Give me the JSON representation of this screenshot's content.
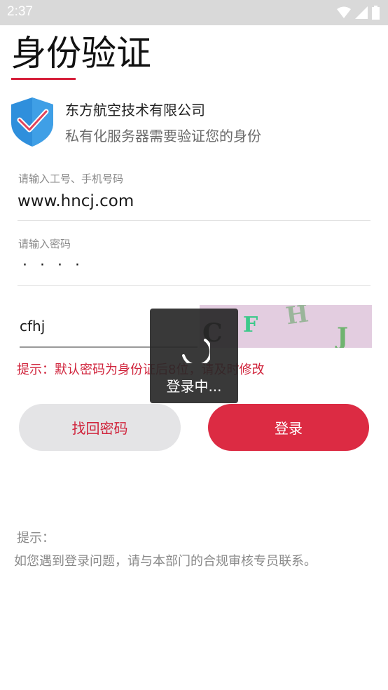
{
  "status_bar": {
    "time": "2:37"
  },
  "page": {
    "title": "身份验证"
  },
  "company": {
    "name": "东方航空技术有限公司",
    "description": "私有化服务器需要验证您的身份"
  },
  "form": {
    "account": {
      "label": "请输入工号、手机号码",
      "value": "www.hncj.com"
    },
    "password": {
      "label": "请输入密码",
      "masked": "····"
    },
    "captcha": {
      "value": "cfhj",
      "image_text": [
        "C",
        "F",
        "H",
        "J"
      ]
    },
    "hint": "提示：默认密码为身份证后8位，请及时修改"
  },
  "buttons": {
    "forgot": "找回密码",
    "login": "登录"
  },
  "notes": {
    "title": "提示：",
    "body": "如您遇到登录问题，请与本部门的合规审核专员联系。"
  },
  "loading": {
    "text": "登录中..."
  },
  "colors": {
    "accent": "#dc2b43",
    "hint_red": "#d0243c",
    "shield_blue": "#2f8fdc"
  }
}
